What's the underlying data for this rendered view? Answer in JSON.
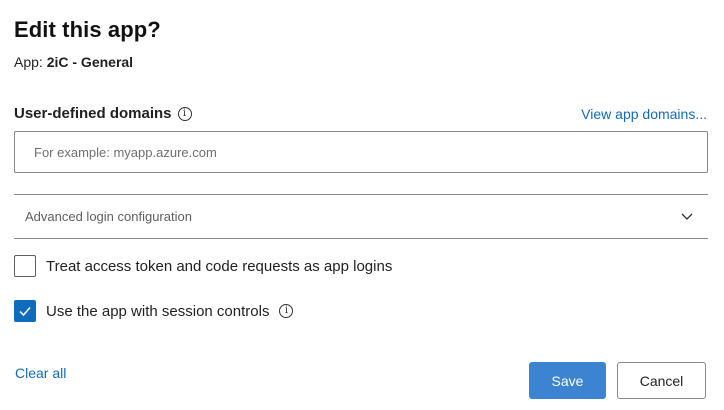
{
  "dialog": {
    "title": "Edit this app?",
    "subtitle_prefix": "App:",
    "app_name": "2iC - General"
  },
  "domains": {
    "label": "User-defined domains",
    "info_icon": "info-icon",
    "view_link": "View app domains...",
    "value": "",
    "placeholder": "For example: myapp.azure.com"
  },
  "advanced": {
    "label": "Advanced login configuration",
    "icon": "chevron-down-icon",
    "expanded": false
  },
  "options": [
    {
      "label": "Treat access token and code requests as app logins",
      "checked": false
    },
    {
      "label": "Use the app with session controls",
      "checked": true,
      "info_icon": "info-icon"
    }
  ],
  "footer": {
    "clear_label": "Clear all",
    "save_label": "Save",
    "cancel_label": "Cancel"
  },
  "colors": {
    "accent": "#0f6cbd",
    "primary_button": "#3c84d1",
    "border": "#8a8886"
  }
}
